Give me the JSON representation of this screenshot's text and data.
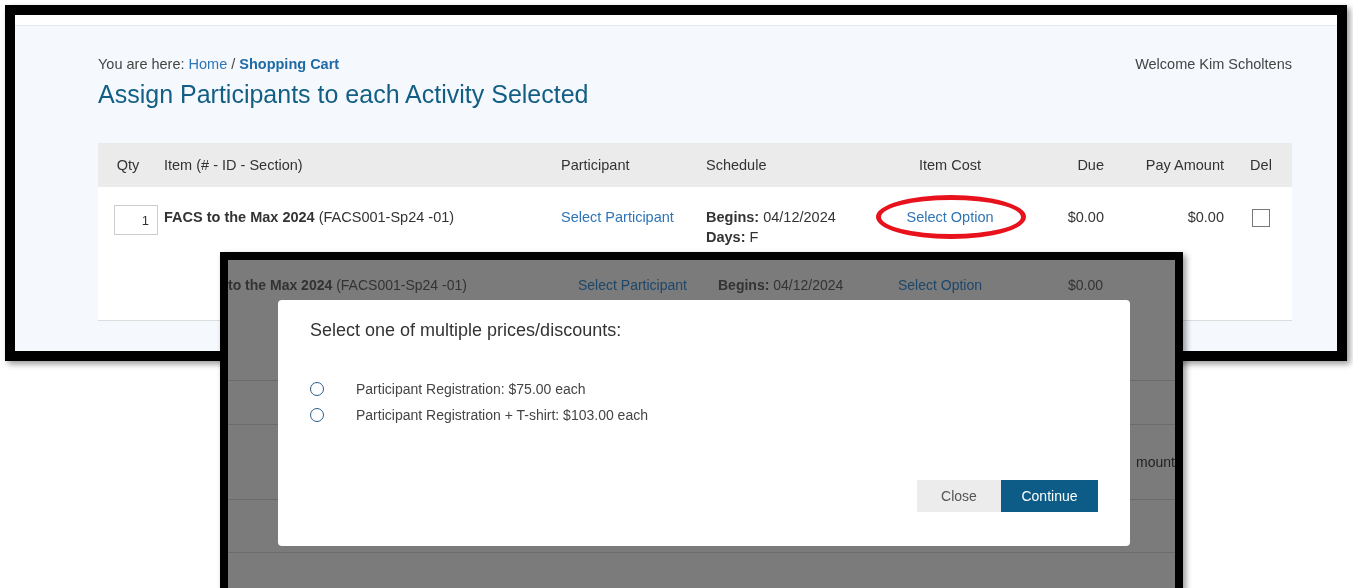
{
  "cart_page": {
    "breadcrumb": {
      "prefix": "You are here:",
      "home": "Home",
      "separator": "/",
      "current": "Shopping Cart"
    },
    "welcome": "Welcome Kim Scholtens",
    "heading": "Assign Participants to each Activity Selected",
    "columns": [
      "Qty",
      "Item (# - ID - Section)",
      "Participant",
      "Schedule",
      "Item Cost",
      "Due",
      "Pay Amount",
      "Del"
    ],
    "row": {
      "qty": "1",
      "item_name": "FACS to the Max 2024",
      "item_code": "(FACS001-Sp24 -01)",
      "participant": "Select Participant",
      "begins_label": "Begins:",
      "begins": "04/12/2024",
      "days_label": "Days:",
      "days": "F",
      "item_cost": "Select Option",
      "item_cost_highlighted": true,
      "due": "$0.00",
      "pay_amount": "$0.00",
      "delete": false
    }
  },
  "dialog_screen": {
    "background_row": {
      "item_name": "to the Max 2024",
      "item_code": "(FACS001-Sp24 -01)",
      "participant": "Select Participant",
      "begins_label": "Begins:",
      "begins": "04/12/2024",
      "item_cost": "Select Option",
      "due": "$0.00",
      "cut_text": "mount"
    },
    "dialog": {
      "title": "Select one of multiple prices/discounts:",
      "options": [
        {
          "label": "Participant Registration: $75.00 each",
          "selected": false
        },
        {
          "label": "Participant Registration + T-shirt: $103.00 each",
          "selected": false
        }
      ],
      "buttons": [
        {
          "label": "Close",
          "kind": "secondary"
        },
        {
          "label": "Continue",
          "kind": "primary"
        }
      ]
    }
  }
}
